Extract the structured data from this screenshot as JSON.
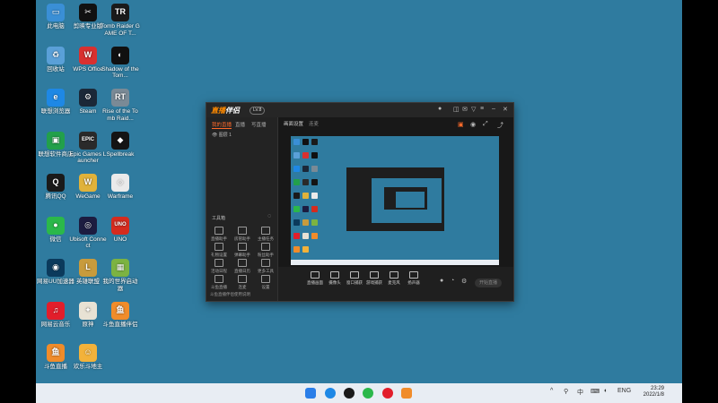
{
  "desktop": {
    "icons": [
      {
        "label": "此电脑",
        "glyph": "▭",
        "color": "#3a8fd6"
      },
      {
        "label": "剪映专业版",
        "glyph": "✂",
        "color": "#111111"
      },
      {
        "label": "Tomb Raider GAME OF T...",
        "glyph": "TR",
        "color": "#1a1a1a"
      },
      {
        "label": "回收站",
        "glyph": "♻",
        "color": "#5aa0d8"
      },
      {
        "label": "WPS Office",
        "glyph": "W",
        "color": "#d9302f"
      },
      {
        "label": "Shadow of the Tom...",
        "glyph": "◐",
        "color": "#101010"
      },
      {
        "label": "联想浏览器",
        "glyph": "e",
        "color": "#1e88e5"
      },
      {
        "label": "Steam",
        "glyph": "⚙",
        "color": "#1b2838"
      },
      {
        "label": "Rise of the Tomb Raid...",
        "glyph": "RT",
        "color": "#7a8a96"
      },
      {
        "label": "联想软件商店",
        "glyph": "▣",
        "color": "#22a04b"
      },
      {
        "label": "Epic Games Launcher",
        "glyph": "EPIC",
        "color": "#2a2a2a"
      },
      {
        "label": "Spellbreak",
        "glyph": "◆",
        "color": "#141414"
      },
      {
        "label": "腾讯QQ",
        "glyph": "Q",
        "color": "#1a1a1a"
      },
      {
        "label": "WeGame",
        "glyph": "W",
        "color": "#e0b23a"
      },
      {
        "label": "Warframe",
        "glyph": "◇",
        "color": "#eaeaea"
      },
      {
        "label": "微信",
        "glyph": "●",
        "color": "#2bb84a"
      },
      {
        "label": "Ubisoft Connect",
        "glyph": "◎",
        "color": "#1c1c40"
      },
      {
        "label": "UNO",
        "glyph": "UNO",
        "color": "#d52b1e"
      },
      {
        "label": "网易UU加速器",
        "glyph": "◉",
        "color": "#0b3a5c"
      },
      {
        "label": "英雄联盟",
        "glyph": "L",
        "color": "#c89b3c"
      },
      {
        "label": "我的世界启动器",
        "glyph": "▦",
        "color": "#7cb342"
      },
      {
        "label": "网易云音乐",
        "glyph": "♫",
        "color": "#e21e2b"
      },
      {
        "label": "原神",
        "glyph": "✦",
        "color": "#e8e2d4"
      },
      {
        "label": "斗鱼直播伴侣",
        "glyph": "鱼",
        "color": "#f08c2a"
      },
      {
        "label": "斗鱼直播",
        "glyph": "鱼",
        "color": "#f08c2a"
      },
      {
        "label": "欢乐斗地主",
        "glyph": "☺",
        "color": "#f3b23a"
      }
    ]
  },
  "app": {
    "logo_part1": "直播",
    "logo_part2": "伴侣",
    "badge": "LV.8",
    "left_tabs": [
      "我的直播",
      "直播",
      "写直播"
    ],
    "left_header": "图层 1",
    "tools_title": "工具箱",
    "tools": [
      "直播助手",
      "房管助手",
      "主播任务",
      "礼物设置",
      "弹幕助手",
      "粉丝助手",
      "活动日程",
      "直播日历",
      "更多工具",
      "斗鱼直播",
      "连麦",
      "设置"
    ],
    "notice": "斗鱼直播伴侣使用说明",
    "scene_tabs": [
      "画面设置",
      "连麦"
    ],
    "bottom_buttons": [
      "直播画面",
      "摄像头",
      "窗口捕获",
      "游戏捕获",
      "麦克风",
      "扬声器"
    ],
    "golive_label": "开始直播"
  },
  "taskbar": {
    "tray": [
      "^",
      "⚲",
      "中",
      "⌨",
      "◐",
      "ENG"
    ],
    "time": "23:29",
    "date": "2022/1/8"
  },
  "colors": {
    "desktop": "#2f7b9f",
    "accent": "#ff6a2a",
    "taskbar": "#e8edf3"
  }
}
